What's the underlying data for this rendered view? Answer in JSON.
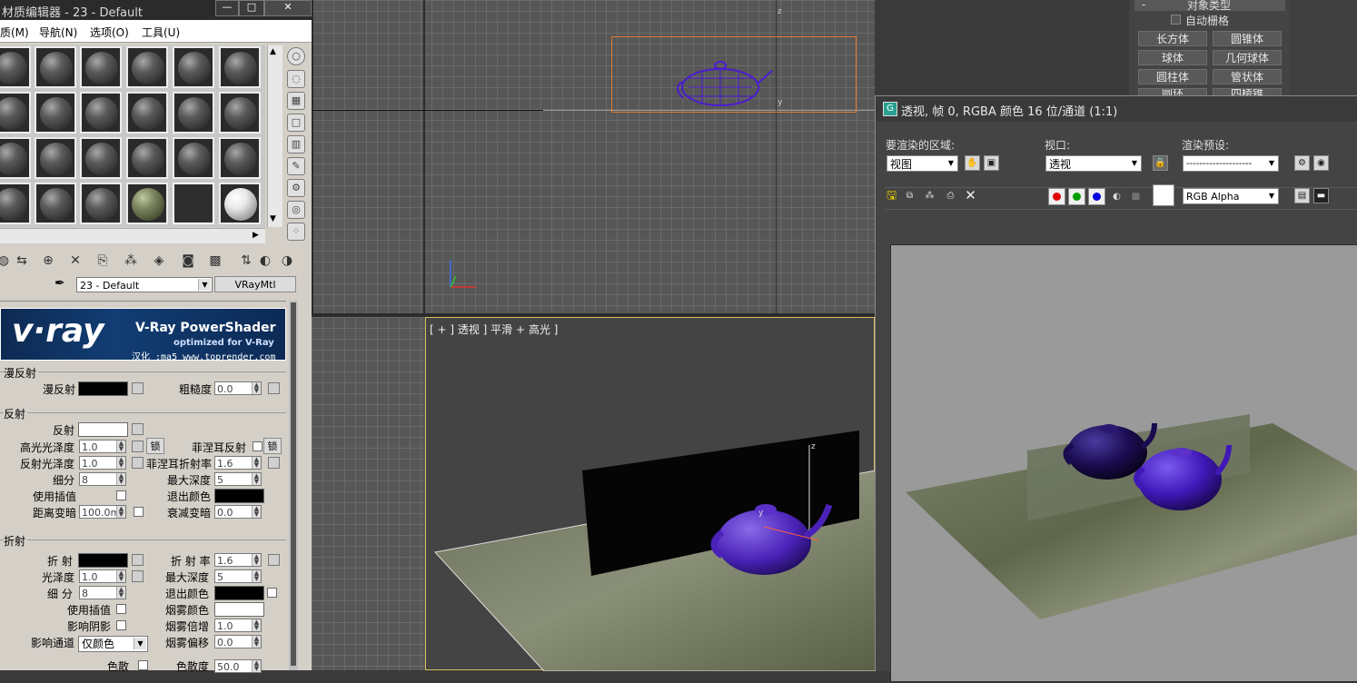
{
  "material_editor": {
    "title": "材质编辑器 - 23 - Default",
    "menu": [
      "质(M)",
      "导航(N)",
      "选项(O)",
      "工具(U)"
    ],
    "material_name": "23 - Default",
    "material_type": "VRayMtl",
    "vray_banner": {
      "brand": "v·ray",
      "product": "V-Ray PowerShader",
      "tagline": "optimized for V-Ray",
      "credit": "汉化 :ma5 www.toprender.com"
    },
    "diffuse": {
      "section": "漫反射",
      "label": "漫反射",
      "roughness_label": "粗糙度",
      "roughness": "0.0"
    },
    "reflection": {
      "section": "反射",
      "reflect_label": "反射",
      "hilight_gloss_label": "高光光泽度",
      "hilight_gloss": "1.0",
      "lock": "锁",
      "fresnel_label": "菲涅耳反射",
      "fresnel_lock": "锁",
      "refl_gloss_label": "反射光泽度",
      "refl_gloss": "1.0",
      "fresnel_ior_label": "菲涅耳折射率",
      "fresnel_ior": "1.6",
      "subdivs_label": "细分",
      "subdivs": "8",
      "max_depth_label": "最大深度",
      "max_depth": "5",
      "use_interp_label": "使用插值",
      "exit_color_label": "退出颜色",
      "dist_dim_label": "距离变暗",
      "dist_dim": "100.0m",
      "falloff_label": "衰减变暗",
      "falloff": "0.0"
    },
    "refraction": {
      "section": "折射",
      "refract_label": "折 射",
      "ior_label": "折 射 率",
      "ior": "1.6",
      "gloss_label": "光泽度",
      "gloss": "1.0",
      "max_depth_label": "最大深度",
      "max_depth": "5",
      "subdivs_label": "细 分",
      "subdivs": "8",
      "exit_color_label": "退出颜色",
      "use_interp_label": "使用插值",
      "fog_color_label": "烟雾颜色",
      "affect_shadows_label": "影响阴影",
      "fog_mult_label": "烟雾倍增",
      "fog_mult": "1.0",
      "affect_channels_label": "影响通道",
      "affect_channels": "仅颜色",
      "fog_bias_label": "烟雾偏移",
      "fog_bias": "0.0",
      "dispersion_label": "色散",
      "abbe_label": "色散度",
      "abbe": "50.0"
    }
  },
  "viewport_top": {
    "axis_z": "z",
    "axis_y": "y"
  },
  "viewport_persp": {
    "label": "[ + ] 透视 ] 平滑 + 高光 ]",
    "axis_z": "z",
    "axis_y": "y"
  },
  "command_panel": {
    "rollout_title": "对象类型",
    "autogrid_label": "自动栅格",
    "buttons": [
      "长方体",
      "圆锥体",
      "球体",
      "几何球体",
      "圆柱体",
      "管状体",
      "圆环",
      "四棱锥"
    ]
  },
  "render_window": {
    "title": "透视, 帧 0, RGBA 颜色 16 位/通道 (1:1)",
    "area_label": "要渲染的区域:",
    "area_value": "视图",
    "viewport_label": "视口:",
    "viewport_value": "透视",
    "preset_label": "渲染预设:",
    "preset_value": "--------------------",
    "channel_value": "RGB Alpha",
    "colors": {
      "red": "#e00000",
      "green": "#00a000",
      "blue": "#0000e0",
      "bg": "#9a9a9a"
    }
  }
}
